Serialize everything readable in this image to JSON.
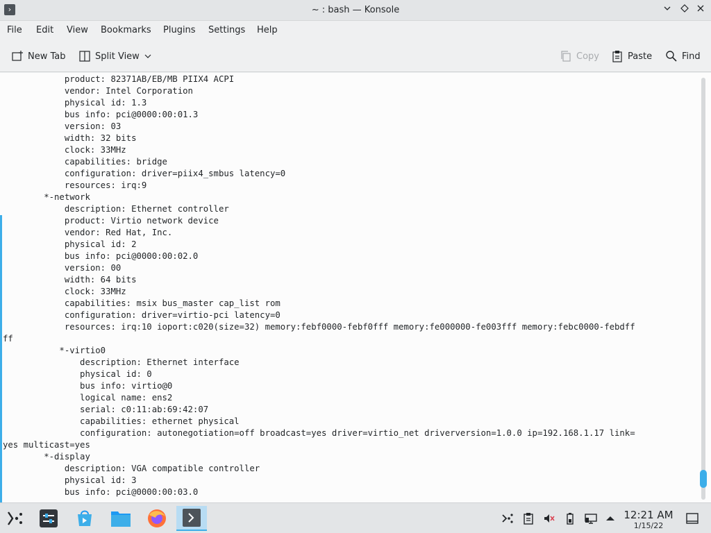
{
  "window": {
    "title": "~ : bash — Konsole",
    "app_icon_glyph": "›"
  },
  "menu": [
    "File",
    "Edit",
    "View",
    "Bookmarks",
    "Plugins",
    "Settings",
    "Help"
  ],
  "toolbar": {
    "new_tab": "New Tab",
    "split_view": "Split View",
    "copy": "Copy",
    "paste": "Paste",
    "find": "Find"
  },
  "terminal": {
    "lines": [
      "            product: 82371AB/EB/MB PIIX4 ACPI",
      "            vendor: Intel Corporation",
      "            physical id: 1.3",
      "            bus info: pci@0000:00:01.3",
      "            version: 03",
      "            width: 32 bits",
      "            clock: 33MHz",
      "            capabilities: bridge",
      "            configuration: driver=piix4_smbus latency=0",
      "            resources: irq:9",
      "        *-network",
      "            description: Ethernet controller",
      "            product: Virtio network device",
      "            vendor: Red Hat, Inc.",
      "            physical id: 2",
      "            bus info: pci@0000:00:02.0",
      "            version: 00",
      "            width: 64 bits",
      "            clock: 33MHz",
      "            capabilities: msix bus_master cap_list rom",
      "            configuration: driver=virtio-pci latency=0",
      "            resources: irq:10 ioport:c020(size=32) memory:febf0000-febf0fff memory:fe000000-fe003fff memory:febc0000-febdff",
      "ff",
      "           *-virtio0",
      "               description: Ethernet interface",
      "               physical id: 0",
      "               bus info: virtio@0",
      "               logical name: ens2",
      "               serial: c0:11:ab:69:42:07",
      "               capabilities: ethernet physical",
      "               configuration: autonegotiation=off broadcast=yes driver=virtio_net driverversion=1.0.0 ip=192.168.1.17 link=",
      "yes multicast=yes",
      "        *-display",
      "            description: VGA compatible controller",
      "            physical id: 3",
      "            bus info: pci@0000:00:03.0"
    ],
    "scroll_position": 0.97
  },
  "taskbar": {
    "apps": [
      "application-launcher-icon",
      "system-settings-icon",
      "discover-store-icon",
      "file-manager-icon",
      "firefox-icon",
      "konsole-icon"
    ],
    "tray": [
      "network-settings-icon",
      "clipboard-icon",
      "volume-muted-icon",
      "battery-icon",
      "display-icon",
      "tray-expand-icon"
    ],
    "time": "12:21 AM",
    "date": "1/15/22"
  }
}
